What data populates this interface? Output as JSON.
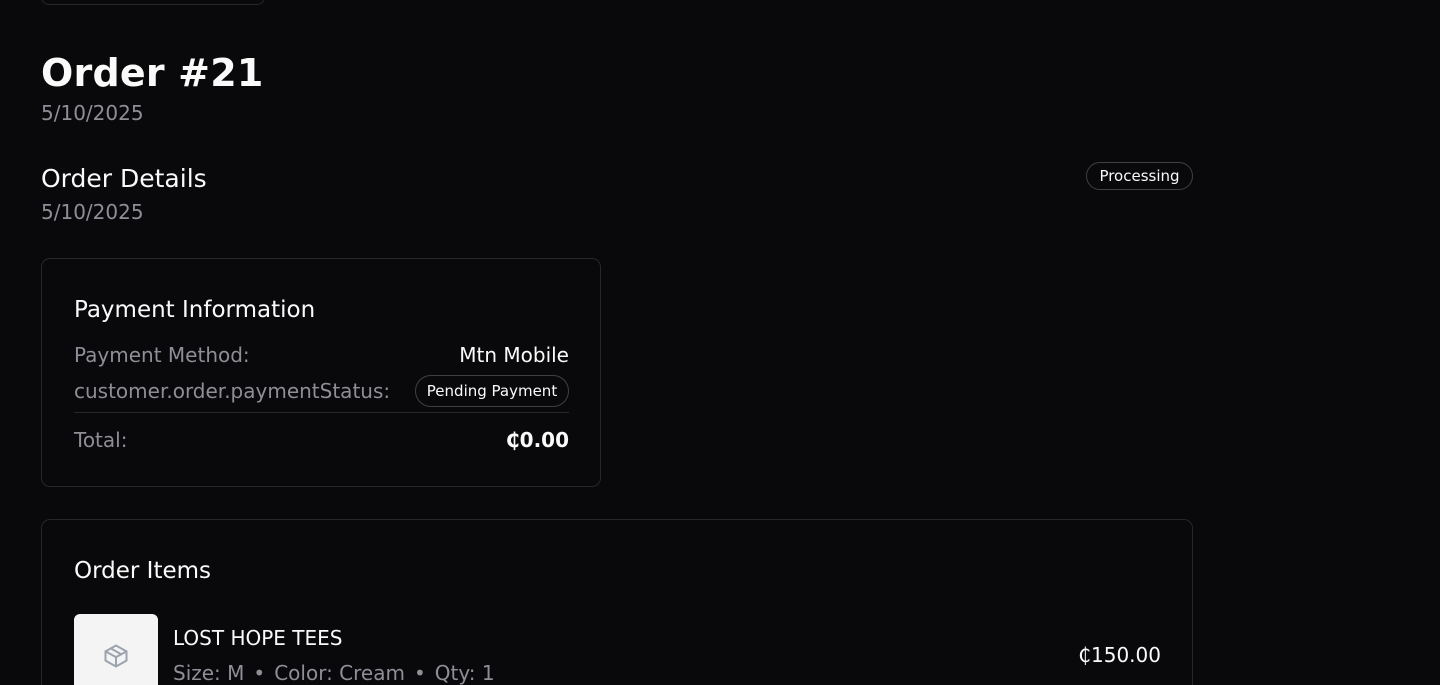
{
  "order": {
    "title": "Order #21",
    "date": "5/10/2025"
  },
  "details": {
    "title": "Order Details",
    "date": "5/10/2025",
    "status": "Processing"
  },
  "payment": {
    "title": "Payment Information",
    "method_label": "Payment Method:",
    "method_value": "Mtn Mobile",
    "status_label": "customer.order.paymentStatus:",
    "status_value": "Pending Payment",
    "total_label": "Total:",
    "total_value": "₵0.00"
  },
  "items": {
    "title": "Order Items",
    "list": [
      {
        "name": "LOST HOPE TEES",
        "size": "Size: M",
        "color": "Color: Cream",
        "qty": "Qty: 1",
        "price": "₵150.00",
        "thumbnail_icon": "package-icon"
      }
    ]
  },
  "meta_separator": "•",
  "colors": {
    "background": "#09090b",
    "border": "#27272a",
    "text": "#fafafa",
    "muted": "#8e8e96",
    "thumbnail_bg": "#f4f4f5"
  }
}
